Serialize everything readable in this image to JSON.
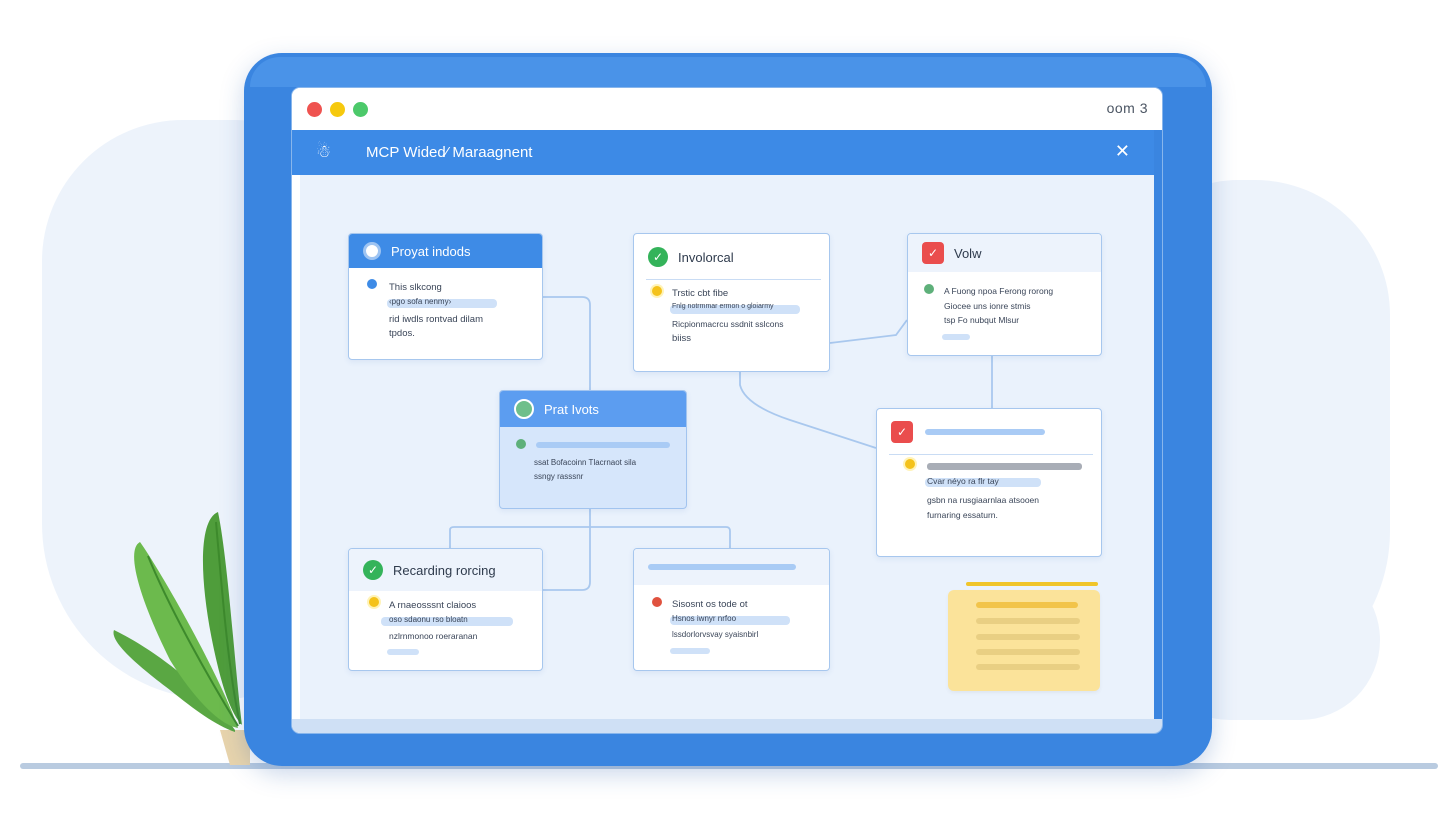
{
  "window": {
    "zoom_label": "oom 3",
    "title": "MCP Wided⁄ Maraagnent"
  },
  "icons": {
    "menu": "☃",
    "close": "✕"
  },
  "cards": {
    "project": {
      "title": "Proyat indods",
      "line1": "This slkcong",
      "line2": "‹pgo sofa nenmy›",
      "line3": "rid iwdls rontvad dilam",
      "line4": "tpdos."
    },
    "involvement": {
      "title": "Involorcal",
      "line1": "Trstic cbt fibe",
      "line2": "Fnlg notrmmar ermon o gloiarmy",
      "line3": "Ricpionmacrcu ssdnit sslcons",
      "line4": "biiss"
    },
    "view": {
      "title": "Volw",
      "line1": "A Fuong npoa Ferong rorong",
      "line2": "Giocee uns ionre stmis",
      "line3": "tsp Fo nubqut Mlsur"
    },
    "notes": {
      "title": "Prat Ivots",
      "line1": "ssat Bofacoinn Tlacrnaot sila",
      "line2": "ssngy rasssnr"
    },
    "flagged": {
      "line1": "Cvar néyo ra flr tay",
      "line2": "gsbn na rusgiaarnlaa atsooen",
      "line3": "furnaring essaturn."
    },
    "recording": {
      "title": "Recarding rorcing",
      "line1": "A rnaeosssnt claioos",
      "line2": "oso sdaonu rso bloatn",
      "line3": "nzlrnmonoo roeraranan"
    },
    "status": {
      "line1": "Sisosnt os tode ot",
      "line2": "Hsnos iwnyr nrfoo",
      "line3": "lssdorlorvsvay syaisnbirl"
    }
  }
}
